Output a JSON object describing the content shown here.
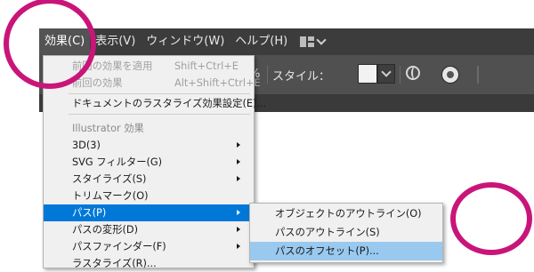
{
  "menubar": {
    "items": [
      "効果(C)",
      "表示(V)",
      "ウィンドウ(W)",
      "ヘルプ(H)"
    ]
  },
  "toolbar": {
    "percent": "%",
    "style_label": "スタイル："
  },
  "effect_menu": {
    "items": [
      {
        "label": "前回の効果を適用",
        "shortcut": "Shift+Ctrl+E",
        "state": "disabled"
      },
      {
        "label": "前回の効果",
        "shortcut": "Alt+Shift+Ctrl+E",
        "state": "disabled"
      },
      {
        "label": "ドキュメントのラスタライズ効果設定(E)...",
        "shortcut": "",
        "state": "enabled"
      },
      {
        "label": "Illustrator 効果",
        "shortcut": "",
        "state": "heading"
      },
      {
        "label": "3D(3)",
        "shortcut": "",
        "state": "enabled",
        "submenu": true
      },
      {
        "label": "SVG フィルター(G)",
        "shortcut": "",
        "state": "enabled",
        "submenu": true
      },
      {
        "label": "スタイライズ(S)",
        "shortcut": "",
        "state": "enabled",
        "submenu": true
      },
      {
        "label": "トリムマーク(O)",
        "shortcut": "",
        "state": "enabled"
      },
      {
        "label": "パス(P)",
        "shortcut": "",
        "state": "highlighted",
        "submenu": true
      },
      {
        "label": "パスの変形(D)",
        "shortcut": "",
        "state": "enabled",
        "submenu": true
      },
      {
        "label": "パスファインダー(F)",
        "shortcut": "",
        "state": "enabled",
        "submenu": true
      },
      {
        "label": "ラスタライズ(R)...",
        "shortcut": "",
        "state": "enabled"
      }
    ]
  },
  "path_submenu": {
    "items": [
      {
        "label": "オブジェクトのアウトライン(O)",
        "state": "enabled"
      },
      {
        "label": "パスのアウトライン(S)",
        "state": "enabled"
      },
      {
        "label": "パスのオフセット(P)...",
        "state": "highlighted"
      }
    ]
  },
  "colors": {
    "menubar_bg": "#3c3c3c",
    "toolbar_bg": "#505050",
    "menu_bg": "#f0f0f0",
    "menu_highlight": "#0078d7",
    "submenu_highlight": "#99c9ef",
    "annotation_ring": "#c9157a"
  }
}
